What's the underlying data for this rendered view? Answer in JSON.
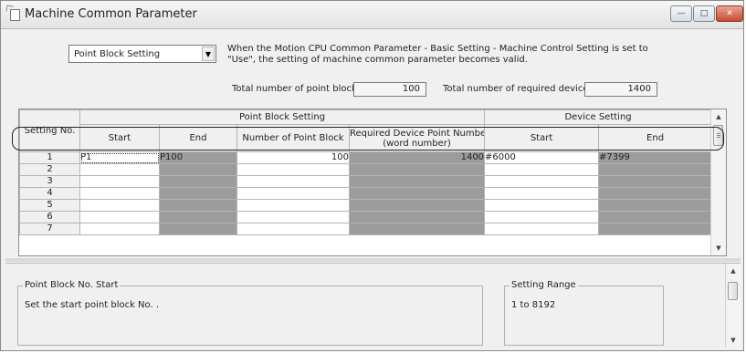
{
  "window": {
    "title": "Machine Common Parameter",
    "buttons": [
      "minimize",
      "maximize",
      "close"
    ]
  },
  "selector": {
    "selected": "Point Block Setting"
  },
  "info_text": {
    "line1": "When the Motion CPU Common Parameter - Basic Setting - Machine Control Setting is set to",
    "line2": "\"Use\", the setting of machine common parameter becomes valid."
  },
  "totals": {
    "point_block_label": "Total number of point block:",
    "point_block_value": "100",
    "required_device_label": "Total number of required device:",
    "required_device_value": "1400"
  },
  "grid": {
    "group_headers": {
      "point_block": "Point Block Setting",
      "device": "Device Setting"
    },
    "columns": {
      "setting_no": "Setting No.",
      "pb_start": "Start",
      "pb_end": "End",
      "pb_count": "Number of Point Block",
      "req_device": "Required Device Point Number",
      "req_device_sub": "(word number)",
      "dev_start": "Start",
      "dev_end": "End"
    },
    "rows": [
      {
        "no": "1",
        "start": "P1",
        "end": "P100",
        "count": "100",
        "required": "1400",
        "dev_start": "#6000",
        "dev_end": "#7399"
      },
      {
        "no": "2",
        "start": "",
        "end": "",
        "count": "",
        "required": "",
        "dev_start": "",
        "dev_end": ""
      },
      {
        "no": "3",
        "start": "",
        "end": "",
        "count": "",
        "required": "",
        "dev_start": "",
        "dev_end": ""
      },
      {
        "no": "4",
        "start": "",
        "end": "",
        "count": "",
        "required": "",
        "dev_start": "",
        "dev_end": ""
      },
      {
        "no": "5",
        "start": "",
        "end": "",
        "count": "",
        "required": "",
        "dev_start": "",
        "dev_end": ""
      },
      {
        "no": "6",
        "start": "",
        "end": "",
        "count": "",
        "required": "",
        "dev_start": "",
        "dev_end": ""
      },
      {
        "no": "7",
        "start": "",
        "end": "",
        "count": "",
        "required": "",
        "dev_start": "",
        "dev_end": ""
      }
    ]
  },
  "help": {
    "title": "Point Block No. Start",
    "description": "Set the start point block No. .",
    "range_title": "Setting Range",
    "range_value": "1 to 8192"
  }
}
